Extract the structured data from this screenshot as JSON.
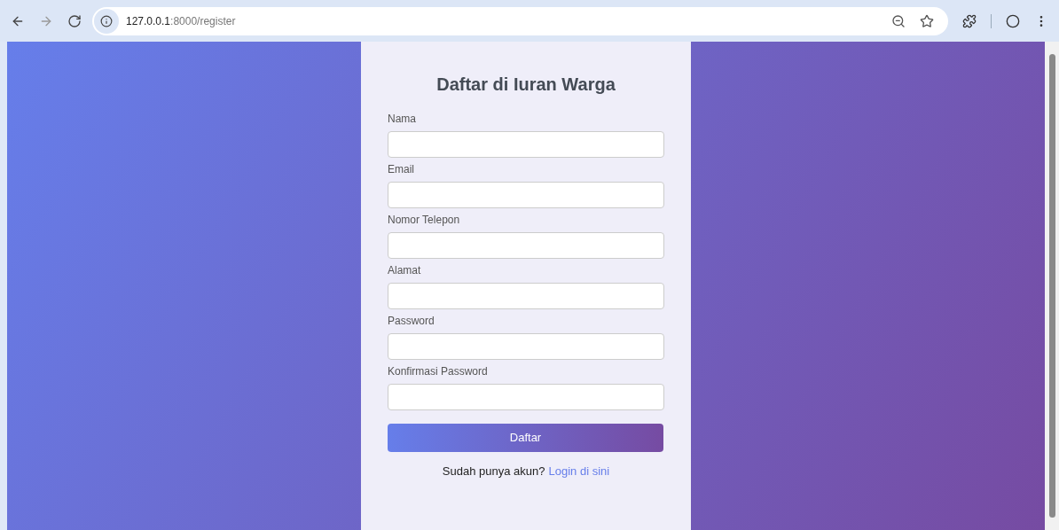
{
  "browser": {
    "url_host": "127.0.0.1",
    "url_path": ":8000/register"
  },
  "form": {
    "title": "Daftar di Iuran Warga",
    "fields": [
      {
        "label": "Nama"
      },
      {
        "label": "Email"
      },
      {
        "label": "Nomor Telepon"
      },
      {
        "label": "Alamat"
      },
      {
        "label": "Password"
      },
      {
        "label": "Konfirmasi Password"
      }
    ],
    "submit": "Daftar",
    "footer_text": "Sudah punya akun?",
    "footer_link": "Login di sini"
  }
}
